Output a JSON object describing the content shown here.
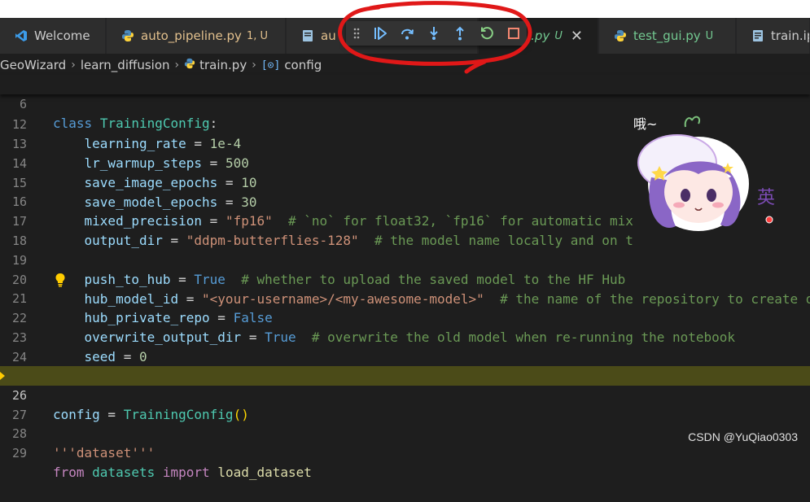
{
  "tabs": [
    {
      "label": "Welcome",
      "icon": "vscode-icon",
      "status": "",
      "badge": ""
    },
    {
      "label": "auto_pipeline.py",
      "icon": "python-icon",
      "status": "mod",
      "badge": "1, U"
    },
    {
      "label": "au",
      "icon": "file-icon",
      "status": "mod",
      "badge": ""
    },
    {
      "label": "i.py",
      "icon": "python-icon",
      "status": "untracked",
      "badge": "U"
    },
    {
      "label": "test_gui.py",
      "icon": "python-icon",
      "status": "untracked",
      "badge": "U"
    },
    {
      "label": "train.ip",
      "icon": "notebook-icon",
      "status": "",
      "badge": ""
    }
  ],
  "debug_toolbar": [
    "drag-grip-icon",
    "continue-icon",
    "step-over-icon",
    "step-into-icon",
    "step-out-icon",
    "restart-icon",
    "stop-icon"
  ],
  "breadcrumb": {
    "p1": "GeoWizard",
    "p2": "learn_diffusion",
    "p3": "train.py",
    "p4": "config"
  },
  "lines": {
    "n6": "6",
    "n12": "12",
    "n13": "13",
    "n14": "14",
    "n15": "15",
    "n16": "16",
    "n17": "17",
    "n18": "18",
    "n19": "19",
    "n20": "20",
    "n21": "21",
    "n22": "22",
    "n23": "23",
    "n24": "24",
    "n25": "25",
    "n26": "26",
    "n27": "27",
    "n28": "28",
    "n29": "29"
  },
  "code": {
    "l6_kw": "class",
    "l6_cls": "TrainingConfig",
    "l6_rest": ":",
    "l12_var": "learning_rate",
    "l12_op": " = ",
    "l12_val": "1e-4",
    "l13_var": "lr_warmup_steps",
    "l13_op": " = ",
    "l13_val": "500",
    "l14_var": "save_image_epochs",
    "l14_op": " = ",
    "l14_val": "10",
    "l15_var": "save_model_epochs",
    "l15_op": " = ",
    "l15_val": "30",
    "l16_var": "mixed_precision",
    "l16_op": " = ",
    "l16_str": "\"fp16\"",
    "l16_cmt": "  # `no` for float32, `fp16` for automatic mix",
    "l17_var": "output_dir",
    "l17_op": " = ",
    "l17_str": "\"ddpm-butterflies-128\"",
    "l17_cmt": "  # the model name locally and on t",
    "l19_var": "push_to_hub",
    "l19_op": " = ",
    "l19_val": "True",
    "l19_cmt": "  # whether to upload the saved model to the HF Hub",
    "l20_var": "hub_model_id",
    "l20_op": " = ",
    "l20_str": "\"<your-username>/<my-awesome-model>\"",
    "l20_cmt": "  # the name of the repository to create o",
    "l21_var": "hub_private_repo",
    "l21_op": " = ",
    "l21_val": "False",
    "l22_var": "overwrite_output_dir",
    "l22_op": " = ",
    "l22_val": "True",
    "l22_cmt": "  # overwrite the old model when re-running the notebook",
    "l23_var": "seed",
    "l23_op": " = ",
    "l23_val": "0",
    "l26_var": "config",
    "l26_op": " = ",
    "l26_cls": "TrainingConfig",
    "l26_br": "()",
    "l28_str": "'''dataset'''",
    "l29_kw": "from",
    "l29_mod": "datasets",
    "l29_kw2": "import",
    "l29_fn": "load_dataset"
  },
  "sticker_text": "哦~",
  "watermark": "CSDN @YuQiao0303",
  "colors": {
    "annotation": "#e01818",
    "keyword": "#569cd6",
    "class": "#4ec9b0",
    "string": "#ce9178",
    "comment": "#6a9955",
    "highlight": "#4b4b18"
  }
}
